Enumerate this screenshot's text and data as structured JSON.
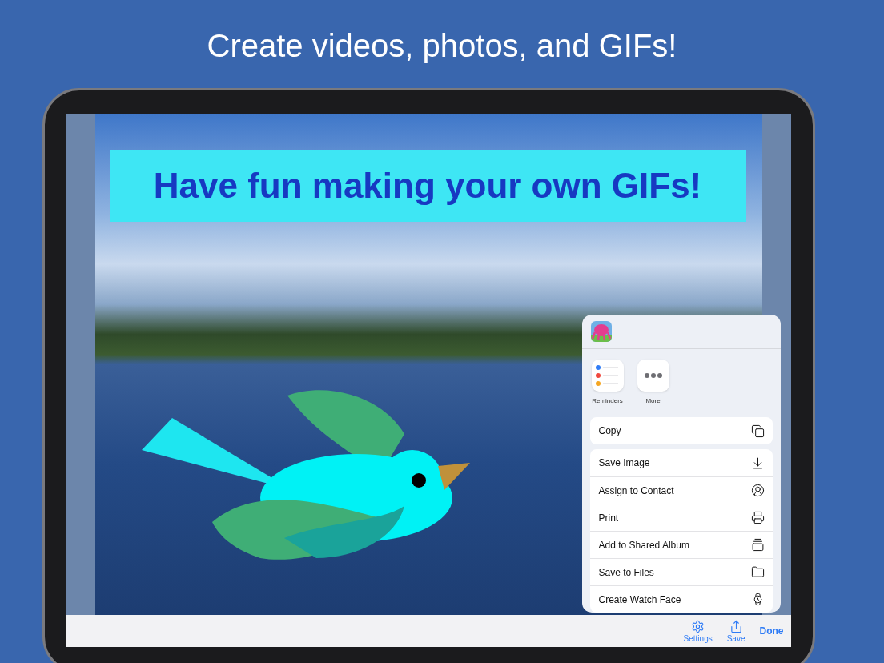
{
  "headline": "Create videos, photos, and GIFs!",
  "canvas": {
    "banner": "Have fun making your own GIFs!"
  },
  "share_sheet": {
    "apps": [
      {
        "label": "Reminders",
        "kind": "reminders"
      },
      {
        "label": "More",
        "kind": "more"
      }
    ],
    "action_groups": [
      [
        {
          "label": "Copy",
          "kind": "copy"
        }
      ],
      [
        {
          "label": "Save Image",
          "kind": "save"
        },
        {
          "label": "Assign to Contact",
          "kind": "contact"
        },
        {
          "label": "Print",
          "kind": "print"
        },
        {
          "label": "Add to Shared Album",
          "kind": "album"
        },
        {
          "label": "Save to Files",
          "kind": "files"
        },
        {
          "label": "Create Watch Face",
          "kind": "watch"
        }
      ]
    ]
  },
  "toolbar": [
    {
      "label": "Settings",
      "kind": "settings"
    },
    {
      "label": "Save",
      "kind": "share"
    },
    {
      "label": "Done",
      "kind": "text"
    }
  ]
}
